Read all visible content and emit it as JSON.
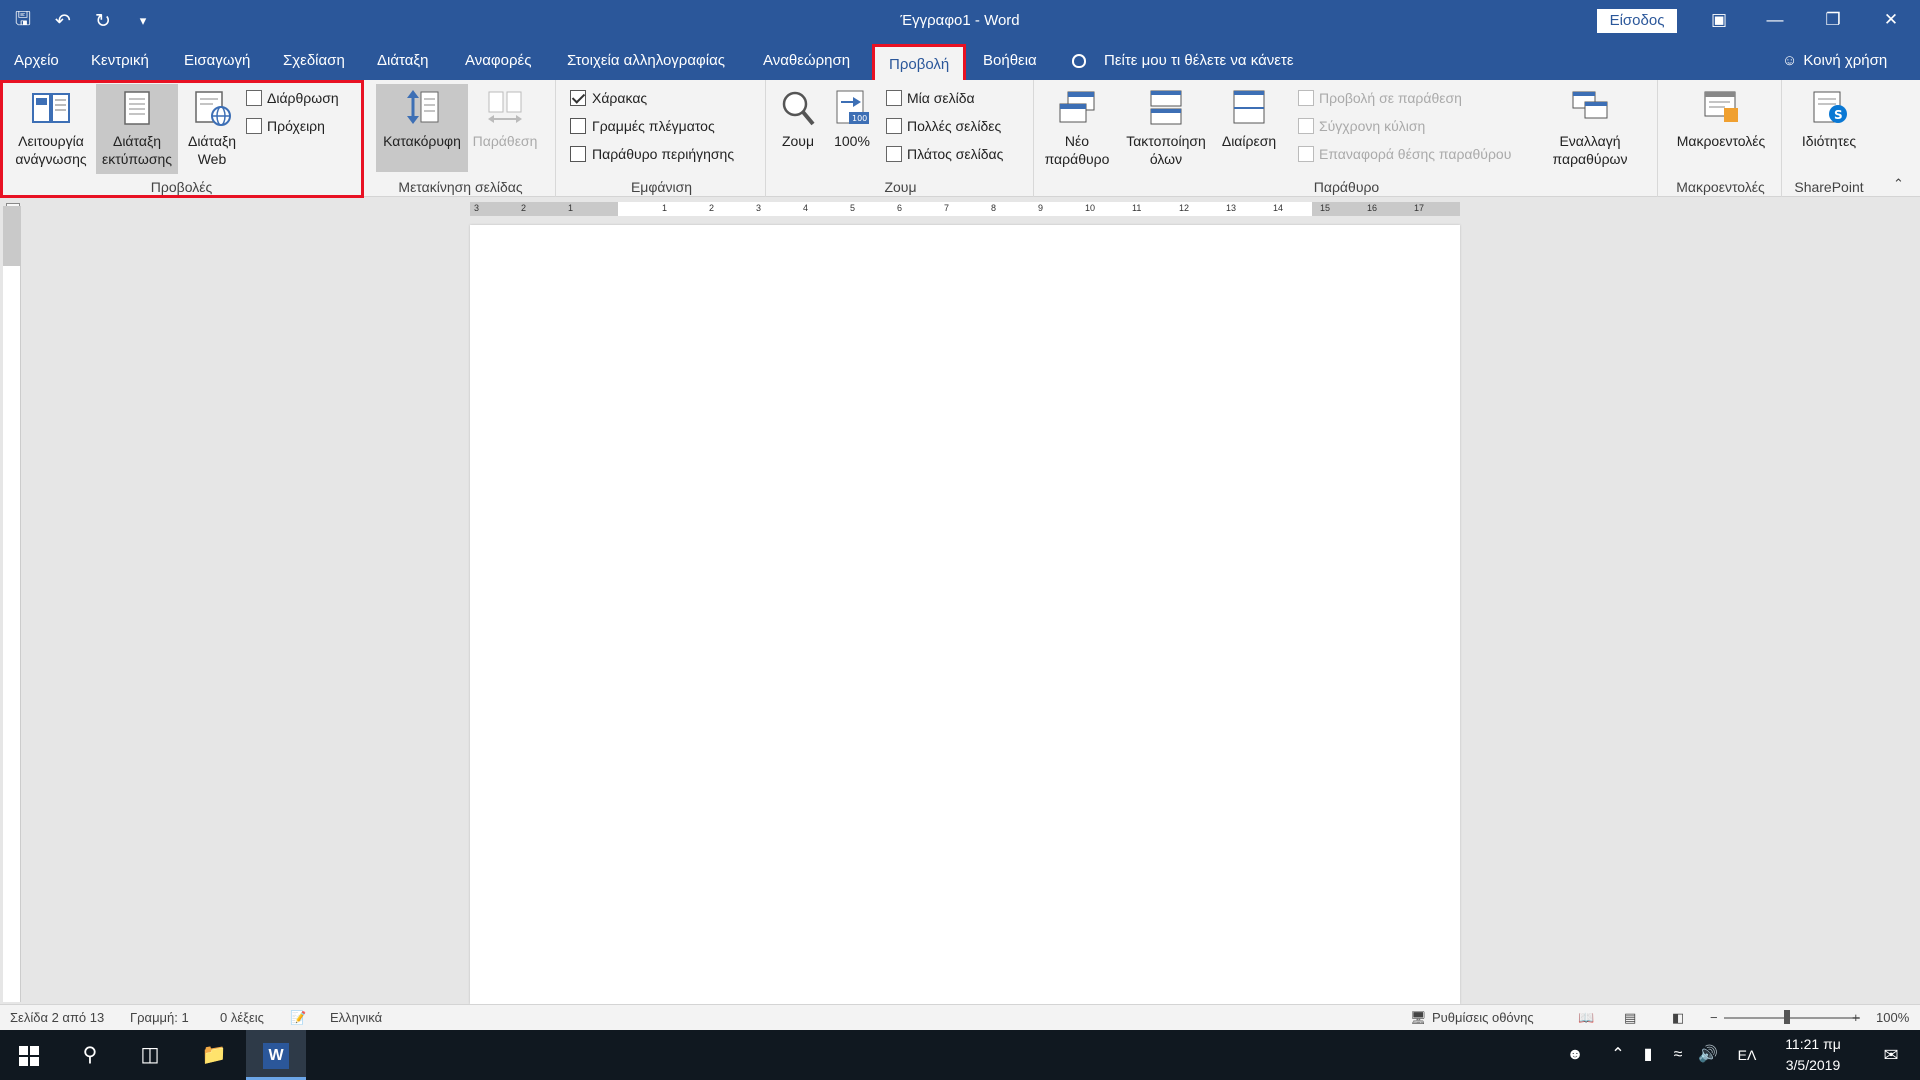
{
  "window": {
    "title": "Έγγραφο1  -  Word",
    "signin_label": "Είσοδος",
    "qat_icons": [
      "save-icon",
      "undo-icon",
      "redo-icon",
      "customize-icon"
    ]
  },
  "tabs": [
    "Αρχείο",
    "Κεντρική",
    "Εισαγωγή",
    "Σχεδίαση",
    "Διάταξη",
    "Αναφορές",
    "Στοιχεία αλληλογραφίας",
    "Αναθεώρηση",
    "Προβολή",
    "Βοήθεια"
  ],
  "active_tab": "Προβολή",
  "tell_me": "Πείτε μου τι θέλετε να κάνετε",
  "share_label": "Κοινή χρήση",
  "ribbon": {
    "views": {
      "label": "Προβολές",
      "read_mode": "Λειτουργία ανάγνωσης",
      "print_layout": "Διάταξη εκτύπωσης",
      "web_layout": "Διάταξη Web",
      "outline": "Διάρθρωση",
      "draft": "Πρόχειρη"
    },
    "page_movement": {
      "label": "Μετακίνηση σελίδας",
      "vertical": "Κατακόρυφη",
      "side_to_side": "Παράθεση"
    },
    "show": {
      "label": "Εμφάνιση",
      "ruler": "Χάρακας",
      "gridlines": "Γραμμές πλέγματος",
      "nav_pane": "Παράθυρο περιήγησης",
      "ruler_checked": true,
      "gridlines_checked": false,
      "nav_pane_checked": false
    },
    "zoom": {
      "label": "Ζουμ",
      "zoom": "Ζουμ",
      "hundred": "100%",
      "one_page": "Μία σελίδα",
      "multiple_pages": "Πολλές σελίδες",
      "page_width": "Πλάτος σελίδας"
    },
    "window": {
      "label": "Παράθυρο",
      "new_window": "Νέο παράθυρο",
      "arrange_all": "Τακτοποίηση όλων",
      "split": "Διαίρεση",
      "side_by_side": "Προβολή σε παράθεση",
      "sync_scroll": "Σύγχρονη κύλιση",
      "reset_pos": "Επαναφορά θέσης παραθύρου",
      "switch_windows": "Εναλλαγή παραθύρων"
    },
    "macros": {
      "label": "Μακροεντολές",
      "macros": "Μακροεντολές"
    },
    "sharepoint": {
      "label": "SharePoint",
      "properties": "Ιδιότητες"
    }
  },
  "ruler_numbers": [
    "3",
    "2",
    "1",
    "1",
    "2",
    "3",
    "4",
    "5",
    "6",
    "7",
    "8",
    "9",
    "10",
    "11",
    "12",
    "13",
    "14",
    "15",
    "16",
    "17"
  ],
  "status": {
    "page": "Σελίδα 2 από 13",
    "line": "Γραμμή: 1",
    "words": "0 λέξεις",
    "language": "Ελληνικά",
    "display_settings": "Ρυθμίσεις οθόνης",
    "zoom_minus": "−",
    "zoom_plus": "+",
    "zoom_pct": "100%"
  },
  "taskbar": {
    "lang": "ΕΛ",
    "time": "11:21 πμ",
    "date": "3/5/2019"
  }
}
